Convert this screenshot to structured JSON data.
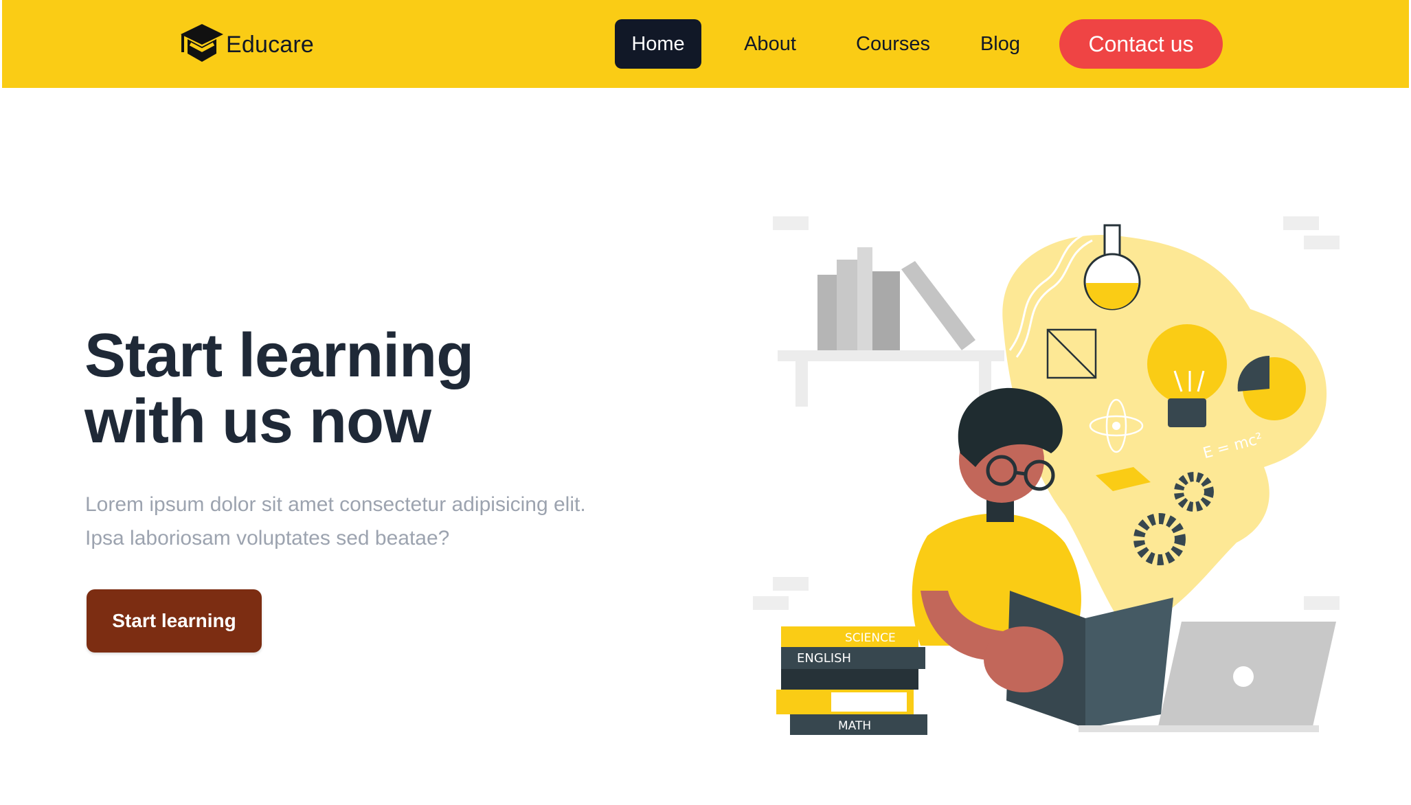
{
  "brand": {
    "name": "Educare",
    "logo_icon": "graduation-cap-logo"
  },
  "nav": {
    "items": [
      {
        "label": "Home",
        "active": true
      },
      {
        "label": "About",
        "active": false
      },
      {
        "label": "Courses",
        "active": false
      },
      {
        "label": "Blog",
        "active": false
      }
    ],
    "contact_label": "Contact us"
  },
  "hero": {
    "title_line1": "Start learning",
    "title_line2": "with us now",
    "subtitle_line1": "Lorem ipsum dolor sit amet consectetur adipisicing elit.",
    "subtitle_line2": "Ipsa laboriosam voluptates sed beatae?",
    "cta_label": "Start learning"
  },
  "illustration": {
    "book_labels": [
      "SCIENCE",
      "ENGLISH",
      "MATH"
    ],
    "formula": "E = mc²"
  },
  "colors": {
    "navbar_bg": "#facc15",
    "nav_active_bg": "#111827",
    "contact_bg": "#ef4444",
    "cta_bg": "#7c2d12",
    "title": "#1f2937",
    "subtitle": "#9ca3af"
  }
}
